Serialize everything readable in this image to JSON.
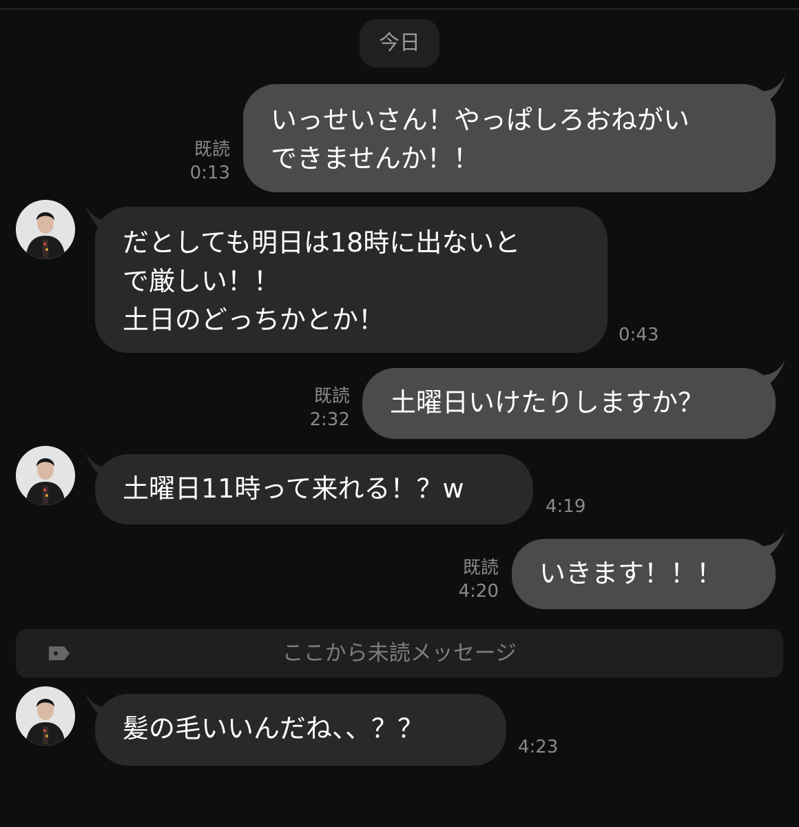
{
  "date_separator": "今日",
  "messages": [
    {
      "side": "out",
      "text": "いっせいさん！やっぱしろおねがい\nできませんか！！",
      "read": "既読",
      "time": "0:13"
    },
    {
      "side": "in",
      "text": "だとしても明日は18時に出ないと\nで厳しい！！\n土日のどっちかとか！",
      "time": "0:43"
    },
    {
      "side": "out",
      "text": "土曜日いけたりしますか？",
      "read": "既読",
      "time": "2:32"
    },
    {
      "side": "in",
      "text": "土曜日11時って来れる！？w",
      "time": "4:19"
    },
    {
      "side": "out",
      "text": "いきます！！！",
      "read": "既読",
      "time": "4:20"
    },
    {
      "side": "in",
      "text": "髪の毛いいんだね、、？？",
      "time": "4:23"
    }
  ],
  "unread_divider": {
    "label": "ここから未読メッセージ",
    "icon": "tag-icon"
  },
  "colors": {
    "background": "#0e0e0e",
    "bubble_out": "#4b4b4b",
    "bubble_in": "#292929",
    "meta": "#8a8a8a"
  }
}
